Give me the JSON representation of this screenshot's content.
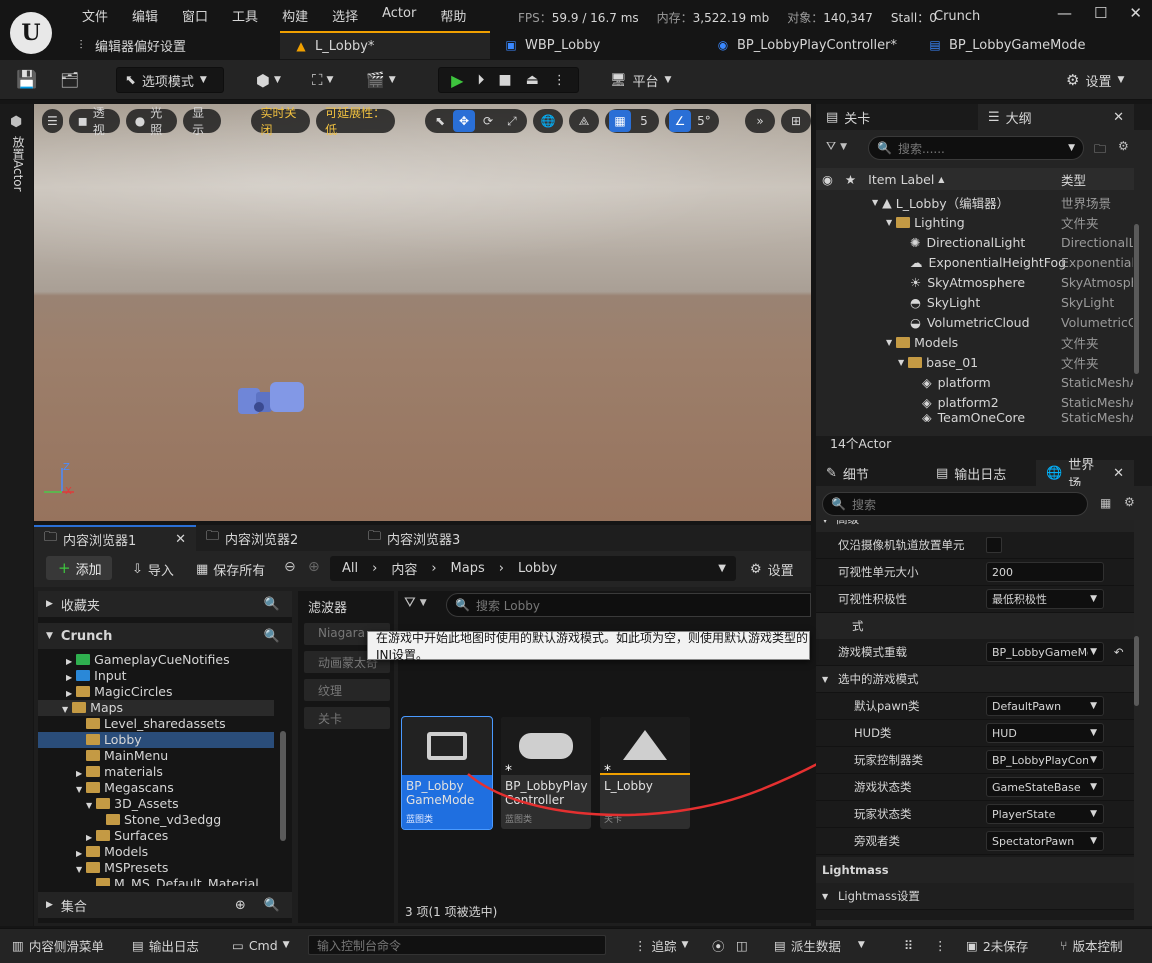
{
  "menu": [
    "文件",
    "编辑",
    "窗口",
    "工具",
    "构建",
    "选择",
    "Actor",
    "帮助"
  ],
  "stats": {
    "fps_label": "FPS：",
    "fps": "59.9",
    "ms": "/ 16.7 ms",
    "mem_label": "内存：",
    "mem": "3,522.19 mb",
    "obj_label": "对象：",
    "obj": "140,347",
    "stall": "Stall：0"
  },
  "project": "Crunch",
  "tabs": [
    {
      "label": "编辑器偏好设置",
      "icon": "sliders-icon"
    },
    {
      "label": "L_Lobby*",
      "icon": "level-icon"
    },
    {
      "label": "WBP_Lobby",
      "icon": "widget-icon"
    },
    {
      "label": "BP_LobbyPlayController*",
      "icon": "gamepad-icon"
    },
    {
      "label": "BP_LobbyGameMode",
      "icon": "blueprint-icon"
    }
  ],
  "toolbar": {
    "mode": "选项模式",
    "platform": "平台",
    "settings": "设置"
  },
  "left_strip": {
    "label": "放置Actor"
  },
  "viewport": {
    "perspective": "透视",
    "lit": "光照",
    "show": "显示",
    "realtime": "实时关闭",
    "scalability": "可延展性：低",
    "grid": "5",
    "angle": "5°",
    "axis_z": "Z",
    "axis_x": "X"
  },
  "content_browser": {
    "tabs": [
      "内容浏览器1",
      "内容浏览器2",
      "内容浏览器3"
    ],
    "add": "添加",
    "import": "导入",
    "save_all": "保存所有",
    "settings": "设置",
    "path": [
      "All",
      "内容",
      "Maps",
      "Lobby"
    ],
    "favorites": "收藏夹",
    "project": "Crunch",
    "collections": "集合",
    "tree": [
      "GameplayCueNotifies",
      "Input",
      "MagicCircles",
      "Maps",
      "Level_sharedassets",
      "Lobby",
      "MainMenu",
      "materials",
      "Megascans",
      "3D_Assets",
      "Stone_vd3edgg",
      "Surfaces",
      "Models",
      "MSPresets",
      "M_MS_Default_Material"
    ],
    "filters_title": "滤波器",
    "filters": [
      "Niagara",
      "动画蒙太奇",
      "纹理",
      "关卡"
    ],
    "search_placeholder": "搜索 Lobby",
    "assets": [
      {
        "name": "BP_Lobby GameMode",
        "type": "蓝图类"
      },
      {
        "name": "BP_LobbyPlay Controller",
        "type": "蓝图类"
      },
      {
        "name": "L_Lobby",
        "type": "关卡"
      }
    ],
    "count": "3 项(1 项被选中)"
  },
  "tooltip": "在游戏中开始此地图时使用的默认游戏模式。如此项为空，则使用默认游戏类型的INI设置。",
  "outliner": {
    "tabs": [
      "关卡",
      "大纲"
    ],
    "search_placeholder": "搜索......",
    "col_label": "Item Label",
    "col_type": "类型",
    "rows": [
      {
        "label": "L_Lobby（编辑器）",
        "type": "世界场景"
      },
      {
        "label": "Lighting",
        "type": "文件夹"
      },
      {
        "label": "DirectionalLight",
        "type": "DirectionalLight"
      },
      {
        "label": "ExponentialHeightFog",
        "type": "ExponentialHeightFog"
      },
      {
        "label": "SkyAtmosphere",
        "type": "SkyAtmosphere"
      },
      {
        "label": "SkyLight",
        "type": "SkyLight"
      },
      {
        "label": "VolumetricCloud",
        "type": "VolumetricCloud"
      },
      {
        "label": "Models",
        "type": "文件夹"
      },
      {
        "label": "base_01",
        "type": "文件夹"
      },
      {
        "label": "platform",
        "type": "StaticMeshActor"
      },
      {
        "label": "platform2",
        "type": "StaticMeshActor"
      },
      {
        "label": "TeamOneCore",
        "type": "StaticMeshActor"
      }
    ],
    "count": "14个Actor"
  },
  "details": {
    "tabs": [
      "细节",
      "输出日志",
      "世界场..."
    ],
    "search_placeholder": "搜索",
    "rows": [
      {
        "label": "高级",
        "value": ""
      },
      {
        "label": "仅沿摄像机轨道放置单元",
        "value": ""
      },
      {
        "label": "可视性单元大小",
        "value": "200"
      },
      {
        "label": "可视性积极性",
        "value": "最低积极性"
      },
      {
        "label": "式",
        "value": ""
      },
      {
        "label": "游戏模式重载",
        "value": "BP_LobbyGameMode"
      },
      {
        "label": "选中的游戏模式",
        "value": ""
      },
      {
        "label": "默认pawn类",
        "value": "DefaultPawn"
      },
      {
        "label": "HUD类",
        "value": "HUD"
      },
      {
        "label": "玩家控制器类",
        "value": "BP_LobbyPlayController"
      },
      {
        "label": "游戏状态类",
        "value": "GameStateBase"
      },
      {
        "label": "玩家状态类",
        "value": "PlayerState"
      },
      {
        "label": "旁观者类",
        "value": "SpectatorPawn"
      },
      {
        "label": "Lightmass",
        "value": ""
      },
      {
        "label": "Lightmass设置",
        "value": ""
      }
    ]
  },
  "status": {
    "drawer": "内容侧滑菜单",
    "log": "输出日志",
    "cmd": "Cmd",
    "console_placeholder": "输入控制台命令",
    "trace": "追踪",
    "derived": "派生数据",
    "unsaved": "2未保存",
    "source": "版本控制"
  }
}
